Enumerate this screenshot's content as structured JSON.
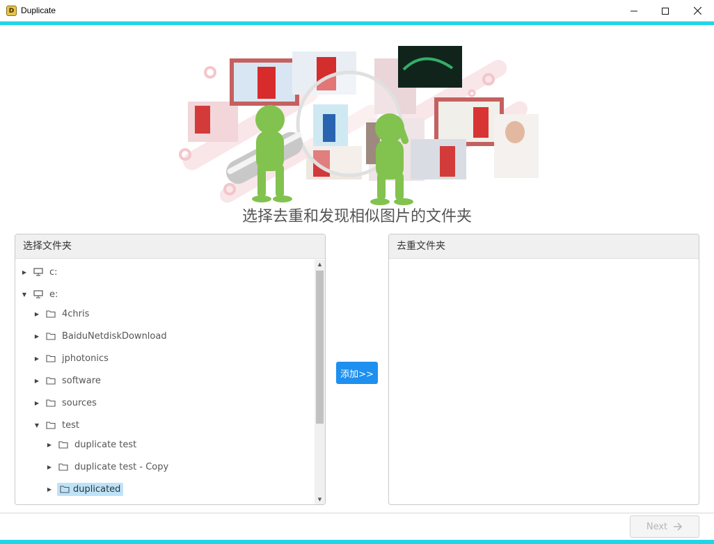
{
  "window": {
    "title": "Duplicate",
    "app_icon_letter": "D",
    "controls": {
      "minimize": "—",
      "maximize": "☐",
      "close": "✕"
    },
    "accent_color": "#1fd6e8"
  },
  "banner": {
    "caption": "选择去重和发现相似图片的文件夹"
  },
  "left_panel": {
    "title": "选择文件夹",
    "tree": [
      {
        "label": "c:",
        "type": "drive",
        "expanded": false,
        "level": 0
      },
      {
        "label": "e:",
        "type": "drive",
        "expanded": true,
        "level": 0
      },
      {
        "label": "4chris",
        "type": "folder",
        "expanded": false,
        "level": 1
      },
      {
        "label": "BaiduNetdiskDownload",
        "type": "folder",
        "expanded": false,
        "level": 1
      },
      {
        "label": "jphotonics",
        "type": "folder",
        "expanded": false,
        "level": 1
      },
      {
        "label": "software",
        "type": "folder",
        "expanded": false,
        "level": 1
      },
      {
        "label": "sources",
        "type": "folder",
        "expanded": false,
        "level": 1
      },
      {
        "label": "test",
        "type": "folder",
        "expanded": true,
        "level": 1
      },
      {
        "label": "duplicate test",
        "type": "folder",
        "expanded": false,
        "level": 2
      },
      {
        "label": "duplicate test - Copy",
        "type": "folder",
        "expanded": false,
        "level": 2
      },
      {
        "label": "duplicated",
        "type": "folder",
        "expanded": false,
        "level": 2,
        "selected": true
      }
    ]
  },
  "add_button": {
    "label": "添加>>",
    "color": "#1e90ef"
  },
  "right_panel": {
    "title": "去重文件夹"
  },
  "footer": {
    "next_label": "Next",
    "next_icon": "arrow-right-icon",
    "next_enabled": false
  }
}
